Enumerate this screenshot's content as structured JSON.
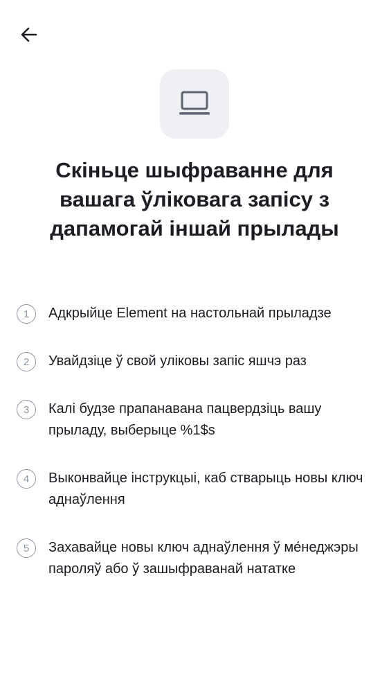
{
  "header": {
    "back_icon": "arrow-left-icon"
  },
  "hero": {
    "icon": "laptop-icon"
  },
  "title": "Скіньце шыфраванне для вашага ўліковага запісу з дапамогай іншай прылады",
  "steps": [
    {
      "number": "1",
      "text": "Адкрыйце Element на настольнай прыладзе"
    },
    {
      "number": "2",
      "text": "Увайдзіце ў свой уліковы запіс яшчэ раз"
    },
    {
      "number": "3",
      "text": "Калі будзе прапанавана пацвердзіць вашу прыладу, выберыце %1$s"
    },
    {
      "number": "4",
      "text": "Выконвайце інструкцыі, каб стварыць новы ключ аднаўлення"
    },
    {
      "number": "5",
      "text": "Захавайце новы ключ аднаўлення ў ме́неджэры пароляў або ў зашыфраванай нататке"
    }
  ]
}
